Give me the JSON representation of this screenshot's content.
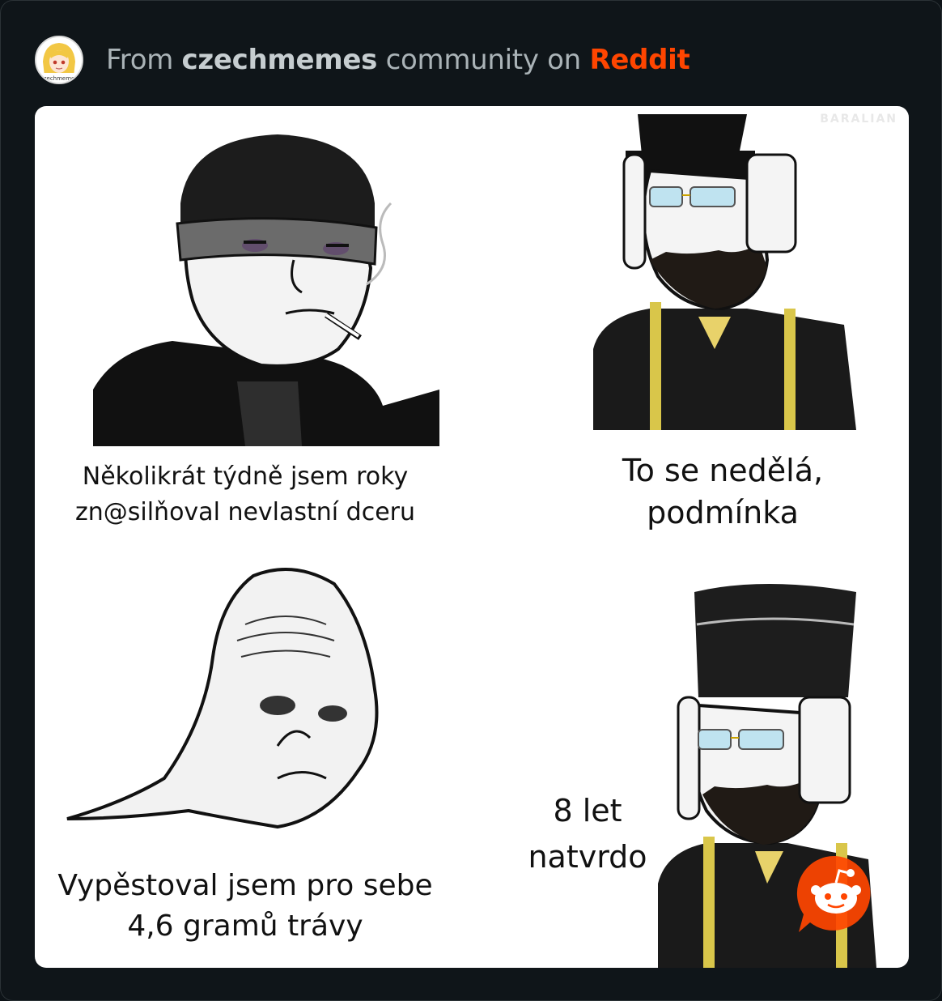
{
  "header": {
    "avatar_label": "czechmemes",
    "prefix": "From ",
    "community": "czechmemes",
    "middle": " community on ",
    "brand": "Reddit"
  },
  "meme": {
    "watermark": "BARALIAN",
    "panel1_caption_line1": "Několikrát týdně jsem roky",
    "panel1_caption_line2": "zn@silňoval nevlastní dceru",
    "panel2_caption_line1": "To se nedělá,",
    "panel2_caption_line2": "podmínka",
    "panel3_caption_line1": "Vypěstoval jsem pro sebe",
    "panel3_caption_line2": "4,6 gramů trávy",
    "panel4_caption_line1": "8 let",
    "panel4_caption_line2": "natvrdo"
  },
  "colors": {
    "background": "#0d1317",
    "brand": "#ff4500"
  }
}
